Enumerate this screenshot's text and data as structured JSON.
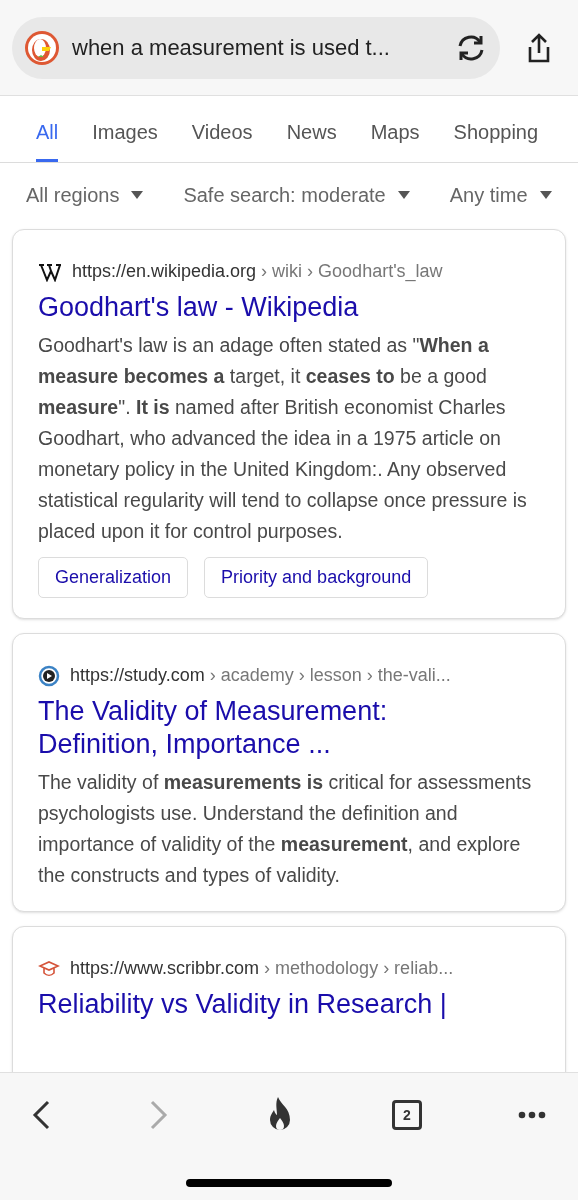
{
  "address_bar": {
    "query": "when a measurement is used t..."
  },
  "tabs": [
    {
      "label": "All",
      "selected": true
    },
    {
      "label": "Images",
      "selected": false
    },
    {
      "label": "Videos",
      "selected": false
    },
    {
      "label": "News",
      "selected": false
    },
    {
      "label": "Maps",
      "selected": false
    },
    {
      "label": "Shopping",
      "selected": false
    }
  ],
  "filters": [
    {
      "label": "All regions"
    },
    {
      "label": "Safe search: moderate"
    },
    {
      "label": "Any time"
    }
  ],
  "results": [
    {
      "kind": "wikipedia",
      "site": "https://en.wikipedia.org",
      "path": " › wiki › Goodhart's_law",
      "title": "Goodhart's law - Wikipedia",
      "snippet": "Goodhart's law is an adage often stated as \"**When a measure becomes a** target, it **ceases to** be a good **measure**\". **It is** named after British economist Charles Goodhart, who advanced the idea in a 1975 article on monetary policy in the United Kingdom:. Any observed statistical regularity will tend to collapse once pressure is placed upon it for control purposes.",
      "links": [
        "Generalization",
        "Priority and background"
      ]
    },
    {
      "kind": "play",
      "site": "https://study.com",
      "path": " › academy › lesson › the-vali...",
      "title": "The Validity of Measurement: Definition, Importance ...",
      "snippet": "The validity of **measurements is** critical for assessments psychologists use. Understand the definition and importance of validity of the **measurement**, and explore the constructs and types of validity."
    },
    {
      "kind": "cap",
      "site": "https://www.scribbr.com",
      "path": " › methodology › reliab...",
      "title": "Reliability vs Validity in Research |"
    }
  ],
  "toolbar": {
    "back_disabled": false,
    "forward_disabled": true,
    "tab_count": "2"
  }
}
